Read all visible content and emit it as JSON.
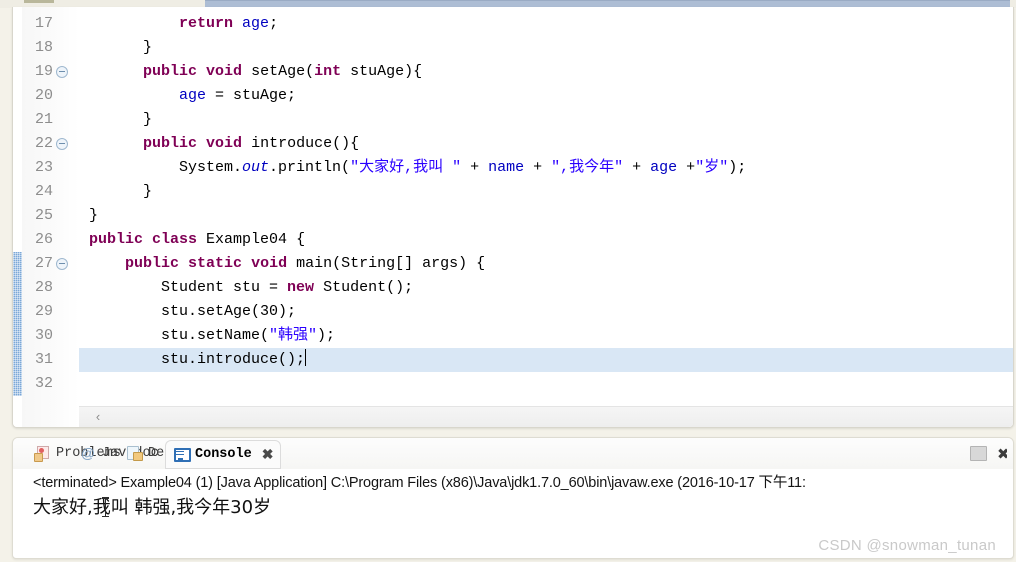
{
  "editor": {
    "first_visible_line": 17,
    "highlighted_line": 31,
    "changed_lines": [
      27,
      28,
      29,
      30,
      31,
      32
    ],
    "fold_markers": [
      19,
      22,
      27
    ],
    "scroll_left_arrow": "‹",
    "lines": [
      {
        "num": "17",
        "indent": 5,
        "tokens": [
          {
            "t": "return",
            "c": "kw"
          },
          {
            "t": " ",
            "c": ""
          },
          {
            "t": "age",
            "c": "fld"
          },
          {
            "t": ";",
            "c": ""
          }
        ]
      },
      {
        "num": "18",
        "indent": 3,
        "tokens": [
          {
            "t": "}",
            "c": ""
          }
        ]
      },
      {
        "num": "19",
        "indent": 3,
        "tokens": [
          {
            "t": "public",
            "c": "kw"
          },
          {
            "t": " ",
            "c": ""
          },
          {
            "t": "void",
            "c": "kw"
          },
          {
            "t": " setAge(",
            "c": ""
          },
          {
            "t": "int",
            "c": "kw"
          },
          {
            "t": " stuAge){",
            "c": ""
          }
        ]
      },
      {
        "num": "20",
        "indent": 5,
        "tokens": [
          {
            "t": "age",
            "c": "fld"
          },
          {
            "t": " = stuAge;",
            "c": ""
          }
        ]
      },
      {
        "num": "21",
        "indent": 3,
        "tokens": [
          {
            "t": "}",
            "c": ""
          }
        ]
      },
      {
        "num": "22",
        "indent": 3,
        "tokens": [
          {
            "t": "public",
            "c": "kw"
          },
          {
            "t": " ",
            "c": ""
          },
          {
            "t": "void",
            "c": "kw"
          },
          {
            "t": " introduce(){",
            "c": ""
          }
        ]
      },
      {
        "num": "23",
        "indent": 5,
        "tokens": [
          {
            "t": "System.",
            "c": ""
          },
          {
            "t": "out",
            "c": "fldi"
          },
          {
            "t": ".println(",
            "c": ""
          },
          {
            "t": "\"大家好,我叫 \"",
            "c": "str"
          },
          {
            "t": " + ",
            "c": ""
          },
          {
            "t": "name",
            "c": "fld"
          },
          {
            "t": " + ",
            "c": ""
          },
          {
            "t": "\",我今年\"",
            "c": "str"
          },
          {
            "t": " + ",
            "c": ""
          },
          {
            "t": "age",
            "c": "fld"
          },
          {
            "t": " +",
            "c": ""
          },
          {
            "t": "\"岁\"",
            "c": "str"
          },
          {
            "t": ");",
            "c": ""
          }
        ]
      },
      {
        "num": "24",
        "indent": 3,
        "tokens": [
          {
            "t": "}",
            "c": ""
          }
        ]
      },
      {
        "num": "25",
        "indent": 0,
        "tokens": [
          {
            "t": "}",
            "c": ""
          }
        ]
      },
      {
        "num": "26",
        "indent": 0,
        "tokens": [
          {
            "t": "public",
            "c": "kw"
          },
          {
            "t": " ",
            "c": ""
          },
          {
            "t": "class",
            "c": "kw"
          },
          {
            "t": " Example04 {",
            "c": ""
          }
        ]
      },
      {
        "num": "27",
        "indent": 2,
        "tokens": [
          {
            "t": "public",
            "c": "kw"
          },
          {
            "t": " ",
            "c": ""
          },
          {
            "t": "static",
            "c": "kw"
          },
          {
            "t": " ",
            "c": ""
          },
          {
            "t": "void",
            "c": "kw"
          },
          {
            "t": " main(String[] args) {",
            "c": ""
          }
        ]
      },
      {
        "num": "28",
        "indent": 4,
        "tokens": [
          {
            "t": "Student stu = ",
            "c": ""
          },
          {
            "t": "new",
            "c": "kw"
          },
          {
            "t": " Student();",
            "c": ""
          }
        ]
      },
      {
        "num": "29",
        "indent": 4,
        "tokens": [
          {
            "t": "stu.setAge(30);",
            "c": ""
          }
        ]
      },
      {
        "num": "30",
        "indent": 4,
        "tokens": [
          {
            "t": "stu.setName(",
            "c": ""
          },
          {
            "t": "\"韩强\"",
            "c": "str"
          },
          {
            "t": ");",
            "c": ""
          }
        ]
      },
      {
        "num": "31",
        "indent": 4,
        "tokens": [
          {
            "t": "stu.introduce();",
            "c": ""
          }
        ]
      },
      {
        "num": "32",
        "indent": 0,
        "tokens": []
      }
    ]
  },
  "bottom_panel": {
    "tabs": [
      {
        "label": "Problems",
        "icon": "problems-icon",
        "active": false,
        "closable": false
      },
      {
        "label": "Javadoc",
        "icon": "javadoc-icon",
        "active": false,
        "closable": false
      },
      {
        "label": "Declaration",
        "icon": "declaration-icon",
        "active": false,
        "closable": false
      },
      {
        "label": "Console",
        "icon": "console-icon",
        "active": true,
        "closable": true
      }
    ],
    "close_glyph": "✖",
    "toolbar": {
      "terminate": "terminate-button",
      "close": "✖"
    },
    "console": {
      "launch_line": "<terminated> Example04 (1) [Java Application] C:\\Program Files (x86)\\Java\\jdk1.7.0_60\\bin\\javaw.exe (2016-10-17 下午11:",
      "output": "大家好,我叫 韩强,我今年30岁"
    }
  },
  "watermark": "CSDN @snowman_tunan",
  "colors": {
    "keyword": "#7F0055",
    "string": "#2A00FF",
    "field": "#0000C0",
    "selection": "#D9E7F5",
    "changebar": "#7BA7D7",
    "tab_active": "#ADBDD4"
  }
}
